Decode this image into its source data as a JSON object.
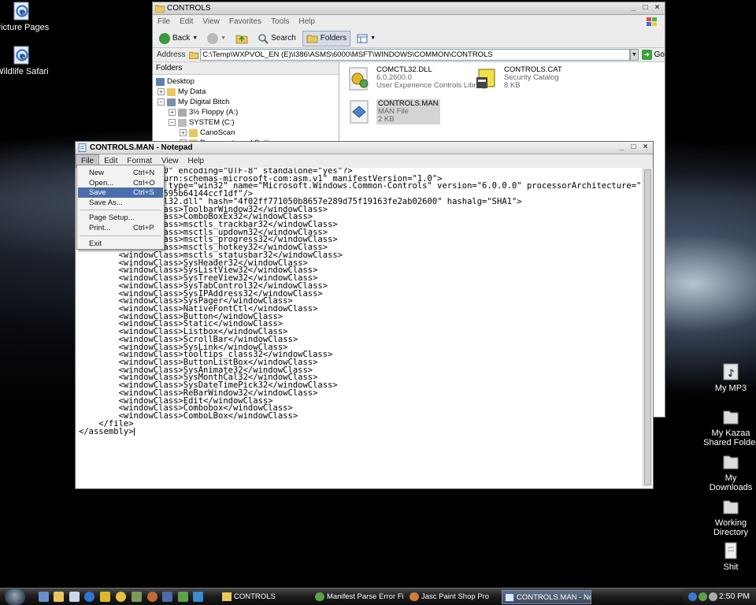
{
  "desktop": {
    "icons_left": [
      {
        "label": "Picture Pages",
        "icon": "ie-globe-icon"
      },
      {
        "label": "Wildlife Safari",
        "icon": "ie-globe-icon"
      }
    ],
    "icons_right": [
      {
        "label": "My MP3",
        "icon": "music-folder-icon"
      },
      {
        "label": "My Kazaa Shared Folder",
        "icon": "folder-icon"
      },
      {
        "label": "My Downloads",
        "icon": "folder-icon"
      },
      {
        "label": "Working Directory",
        "icon": "folder-icon"
      },
      {
        "label": "Shit",
        "icon": "document-icon"
      }
    ]
  },
  "explorer": {
    "title": "CONTROLS",
    "menu": [
      "File",
      "Edit",
      "View",
      "Favorites",
      "Tools",
      "Help"
    ],
    "toolbar": {
      "back": "Back",
      "search": "Search",
      "folders": "Folders"
    },
    "address": {
      "label": "Address",
      "value": "C:\\Temp\\WXPVOL_EN (E)\\I386\\ASMS\\6000\\MSFT\\WINDOWS\\COMMON\\CONTROLS",
      "go": "Go"
    },
    "folders_header": "Folders",
    "tree": [
      "Desktop",
      "My Data",
      "My Digital Bitch",
      "3½ Floppy (A:)",
      "SYSTEM (C:)",
      "CanoScan",
      "Documents and Settings"
    ],
    "files": [
      {
        "name": "COMCTL32.DLL",
        "line2": "6.0.2600.0",
        "line3": "User Experience Controls Library"
      },
      {
        "name": "CONTROLS.CAT",
        "line2": "Security Catalog",
        "line3": "8 KB"
      },
      {
        "name": "CONTROLS.MAN",
        "line2": "MAN File",
        "line3": "2 KB"
      }
    ]
  },
  "notepad": {
    "title": "CONTROLS.MAN - Notepad",
    "menu": [
      "File",
      "Edit",
      "Format",
      "View",
      "Help"
    ],
    "content": "<?xml version=\"1.0\" encoding=\"UTF-8\" standalone=\"yes\"?>\n<assembly xmlns=\"urn:schemas-microsoft-com:asm.v1\" manifestVersion=\"1.0\">\n<assemblyIdentity type=\"win32\" name=\"Microsoft.Windows.Common-Controls\" version=\"6.0.0.0\" processorArchitecture=\"x\npublicKeyToken=\"6595b64144ccf1df\"/>\n<file name=\"comctl32.dll\" hash=\"4f02ff771050b8657e289d75f19163fe2ab02600\" hashalg=\"SHA1\">\n        <windowClass>ToolbarWindow32</windowClass>\n        <windowClass>ComboBoxEx32</windowClass>\n        <windowClass>msctls_trackbar32</windowClass>\n        <windowClass>msctls_updown32</windowClass>\n        <windowClass>msctls_progress32</windowClass>\n        <windowClass>msctls_hotkey32</windowClass>\n        <windowClass>msctls_statusbar32</windowClass>\n        <windowClass>SysHeader32</windowClass>\n        <windowClass>SysListView32</windowClass>\n        <windowClass>SysTreeView32</windowClass>\n        <windowClass>SysTabControl32</windowClass>\n        <windowClass>SysIPAddress32</windowClass>\n        <windowClass>SysPager</windowClass>\n        <windowClass>NativeFontCtl</windowClass>\n        <windowClass>Button</windowClass>\n        <windowClass>Static</windowClass>\n        <windowClass>Listbox</windowClass>\n        <windowClass>ScrollBar</windowClass>\n        <windowClass>SysLink</windowClass>\n        <windowClass>tooltips_class32</windowClass>\n        <windowClass>ButtonListBox</windowClass>\n        <windowClass>SysAnimate32</windowClass>\n        <windowClass>SysMonthCal32</windowClass>\n        <windowClass>SysDateTimePick32</windowClass>\n        <windowClass>ReBarWindow32</windowClass>\n        <windowClass>Edit</windowClass>\n        <windowClass>Combobox</windowClass>\n        <windowClass>ComboLBox</windowClass>\n    </file>\n</assembly>",
    "file_menu": {
      "items": [
        {
          "label": "New",
          "shortcut": "Ctrl+N"
        },
        {
          "label": "Open...",
          "shortcut": "Ctrl+O"
        },
        {
          "label": "Save",
          "shortcut": "Ctrl+S"
        },
        {
          "label": "Save As...",
          "shortcut": ""
        },
        {
          "label": "Page Setup...",
          "shortcut": ""
        },
        {
          "label": "Print...",
          "shortcut": "Ctrl+P"
        },
        {
          "label": "Exit",
          "shortcut": ""
        }
      ],
      "highlighted": "Save"
    }
  },
  "taskbar": {
    "tasks": [
      {
        "label": "CONTROLS",
        "icon": "folder-icon"
      },
      {
        "label": "Manifest Parse Error Fi...",
        "icon": "ie-globe-icon"
      },
      {
        "label": "Jasc Paint Shop Pro",
        "icon": "paint-palette-icon"
      },
      {
        "label": "CONTROLS.MAN - Not...",
        "icon": "notepad-icon"
      }
    ],
    "active_task": "CONTROLS.MAN - Not...",
    "clock": "2:50 PM"
  },
  "colors": {
    "menu_highlight": "#4a6ea9",
    "taskbar": "#1e1e1e",
    "desktop": "#000000"
  }
}
